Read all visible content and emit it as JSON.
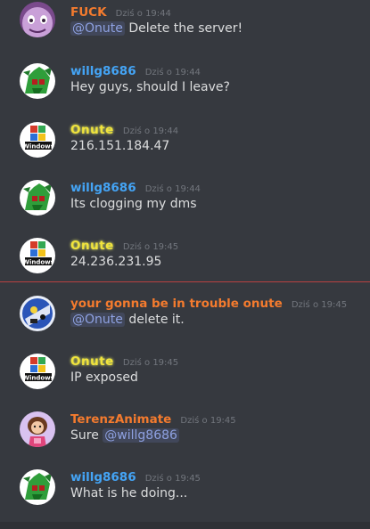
{
  "colors": {
    "background": "#36393f",
    "text": "#dcddde",
    "timestamp": "#72767d",
    "mention": "#8ea1e1",
    "new_messages_line": "#b94141"
  },
  "messages": [
    {
      "author": "FUCK",
      "author_color": "#f47b2e",
      "timestamp": "Dziś o 19:44",
      "avatar_icon": "purple-face-avatar-icon",
      "mention": "@Onute",
      "text": "Delete the server!"
    },
    {
      "author": "willg8686",
      "author_color": "#44a4f5",
      "timestamp": "Dziś o 19:44",
      "avatar_icon": "green-character-avatar-icon",
      "text": "Hey guys, should I leave?"
    },
    {
      "author": "Onute",
      "author_color": "#f1e43c",
      "timestamp": "Dziś o 19:44",
      "avatar_icon": "windows-logo-avatar-icon",
      "text": "216.151.184.47"
    },
    {
      "author": "willg8686",
      "author_color": "#44a4f5",
      "timestamp": "Dziś o 19:44",
      "avatar_icon": "green-character-avatar-icon",
      "text": "Its clogging my dms"
    },
    {
      "author": "Onute",
      "author_color": "#f1e43c",
      "timestamp": "Dziś o 19:45",
      "avatar_icon": "windows-logo-avatar-icon",
      "text": "24.236.231.95"
    },
    {
      "author": "your gonna be in trouble onute",
      "author_color": "#f47b2e",
      "timestamp": "Dziś o 19:45",
      "avatar_icon": "blue-cartoon-avatar-icon",
      "mention": "@Onute",
      "text": "delete it."
    },
    {
      "author": "Onute",
      "author_color": "#f1e43c",
      "timestamp": "Dziś o 19:45",
      "avatar_icon": "windows-logo-avatar-icon",
      "text": "IP exposed"
    },
    {
      "author": "TerenzAnimate",
      "author_color": "#f47b2e",
      "timestamp": "Dziś o 19:45",
      "avatar_icon": "girl-character-avatar-icon",
      "text": "Sure",
      "mention": "@willg8686"
    },
    {
      "author": "willg8686",
      "author_color": "#44a4f5",
      "timestamp": "Dziś o 19:45",
      "avatar_icon": "green-character-avatar-icon",
      "text": "What is he doing..."
    }
  ]
}
